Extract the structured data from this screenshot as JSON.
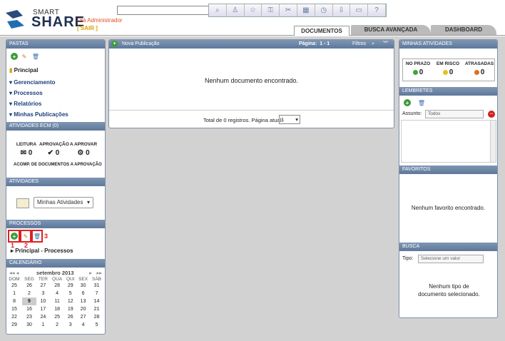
{
  "header": {
    "brand_small": "SMART",
    "brand_big": "SHARE",
    "greeting": "Olá Administrador",
    "logout": "[ SAIR ]",
    "search_placeholder": "",
    "toolbar_icons": [
      "search-icon",
      "user-icon",
      "star-icon",
      "lock-icon",
      "tools-icon",
      "calendar-icon",
      "clock-icon",
      "download-icon",
      "card-icon",
      "help-icon"
    ]
  },
  "tabs": [
    {
      "label": "DOCUMENTOS",
      "active": true
    },
    {
      "label": "BUSCA AVANÇADA",
      "active": false
    },
    {
      "label": "DASHBOARD",
      "active": false
    }
  ],
  "left": {
    "pastas_title": "PASTAS",
    "root_folder": "Principal",
    "folders": [
      "Gerenciamento",
      "Processos",
      "Relatórios",
      "Minhas Publicações"
    ],
    "ecm_title": "ATIVIDADES ECM (0)",
    "ecm_stats": [
      {
        "label": "LEITURA",
        "value": "0"
      },
      {
        "label": "APROVAÇÃO",
        "value": "0"
      },
      {
        "label": "A APROVAR",
        "value": "0"
      }
    ],
    "ecm_footer": "ACOMP. DE DOCUMENTOS A APROVAÇÃO",
    "atividades_title": "ATIVIDADES",
    "atividades_select": "Minhas Atividades",
    "processos_title": "PROCESSOS",
    "processos_root": "Principal - Processos",
    "annotations": [
      "1",
      "2",
      "3"
    ],
    "calendar_title": "CALENDÁRIO",
    "calendar_month": "setembro 2013",
    "calendar_days": [
      "DOM",
      "SEG",
      "TER",
      "QUA",
      "QUI",
      "SEX",
      "SÁB"
    ],
    "calendar_rows": [
      [
        "25",
        "26",
        "27",
        "28",
        "29",
        "30",
        "31"
      ],
      [
        "1",
        "2",
        "3",
        "4",
        "5",
        "6",
        "7"
      ],
      [
        "8",
        "9",
        "10",
        "11",
        "12",
        "13",
        "14"
      ],
      [
        "15",
        "16",
        "17",
        "18",
        "19",
        "20",
        "21"
      ],
      [
        "22",
        "23",
        "24",
        "25",
        "26",
        "27",
        "28"
      ],
      [
        "29",
        "30",
        "1",
        "2",
        "3",
        "4",
        "5"
      ]
    ],
    "calendar_today": "9"
  },
  "center": {
    "new_pub": "Nova Publicação",
    "pagina_label": "Página:",
    "pagina_value": "1 - 1",
    "filtros": "Filtros",
    "empty_msg": "Nenhum documento encontrado.",
    "footer_text": "Total de 0 registros. Página atual:",
    "page_select": "1"
  },
  "right": {
    "minhas_title": "MINHAS ATIVIDADES",
    "stats": [
      {
        "label": "NO PRAZO",
        "value": "0",
        "color": "#3aa83a"
      },
      {
        "label": "EM RISCO",
        "value": "0",
        "color": "#e8c020"
      },
      {
        "label": "ATRASADAS",
        "value": "0",
        "color": "#e07020"
      }
    ],
    "lembretes_title": "LEMBRETES",
    "assunto_label": "Assunto:",
    "assunto_value": "Todos",
    "favoritos_title": "FAVORITOS",
    "favoritos_empty": "Nenhum favorito encontrado.",
    "busca_title": "BUSCA",
    "tipo_label": "Tipo:",
    "tipo_placeholder": "Selecione um valor",
    "busca_empty": "Nenhum tipo de documento selecionado."
  }
}
